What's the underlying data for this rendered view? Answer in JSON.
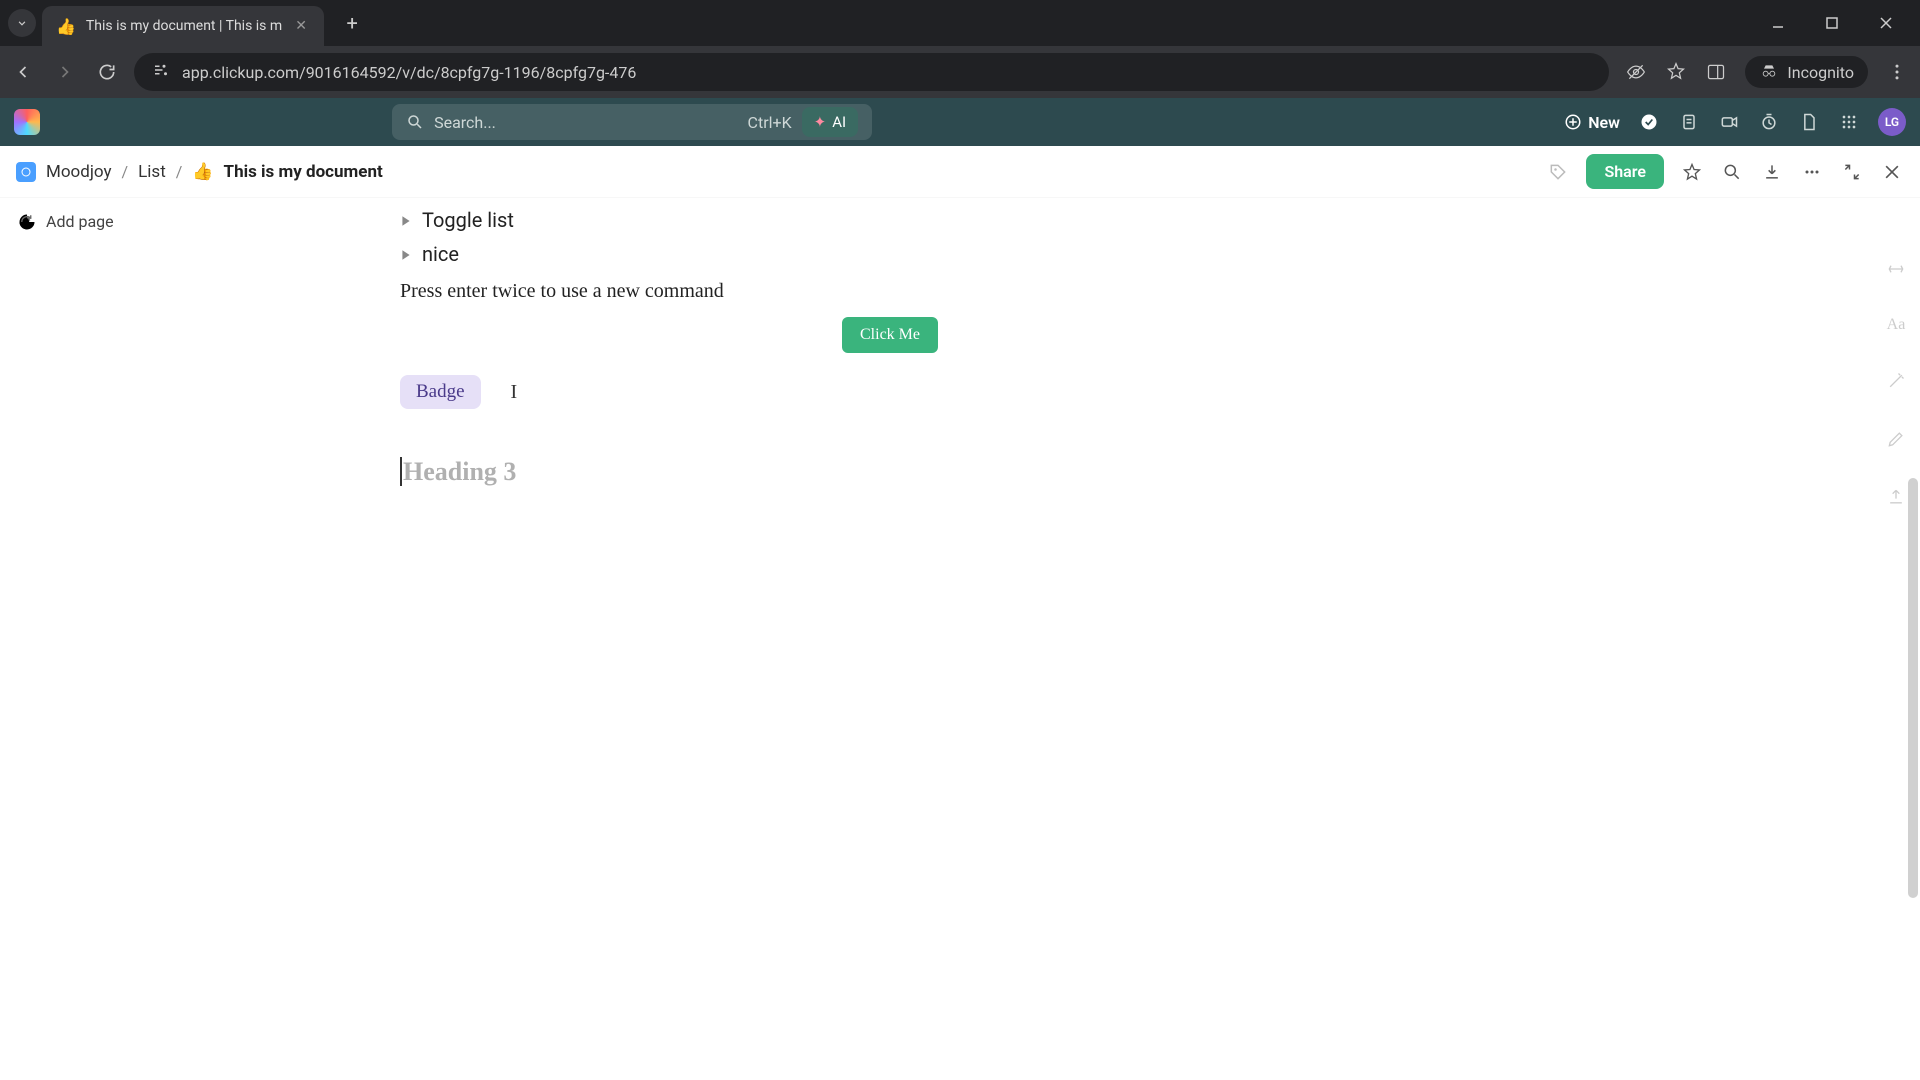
{
  "browser": {
    "tab_title": "This is my document | This is m",
    "tab_emoji": "👍",
    "url": "app.clickup.com/9016164592/v/dc/8cpfg7g-1196/8cpfg7g-476",
    "incognito_label": "Incognito"
  },
  "app_header": {
    "search_placeholder": "Search...",
    "search_shortcut": "Ctrl+K",
    "ai_label": "AI",
    "new_label": "New",
    "avatar_initials": "LG"
  },
  "breadcrumb": {
    "workspace": "Moodjoy",
    "list": "List",
    "doc_emoji": "👍",
    "doc_title": "This is my document",
    "share_label": "Share"
  },
  "sidebar": {
    "add_page": "Add page"
  },
  "document": {
    "toggle1": "Toggle list",
    "toggle2": "nice",
    "hint": "Press enter twice to use a new command",
    "button_label": "Click Me",
    "badge_label": "Badge",
    "heading_placeholder": "Heading 3"
  },
  "right_rail": {
    "aa": "Aa"
  }
}
